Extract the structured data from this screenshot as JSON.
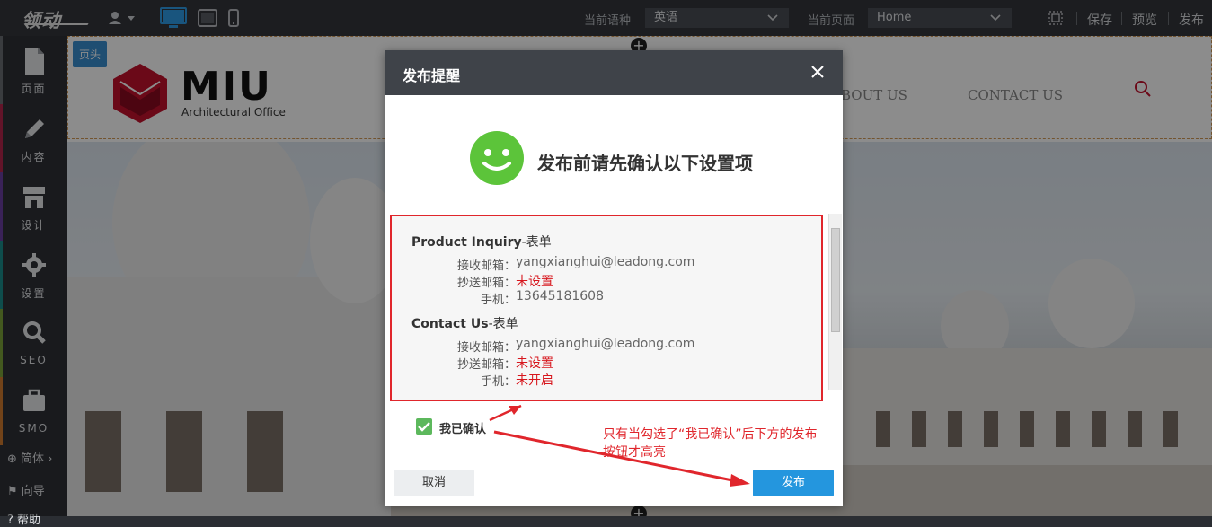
{
  "topbar": {
    "logo": "领动",
    "language_label": "当前语种",
    "language_value": "英语",
    "page_label": "当前页面",
    "page_value": "Home",
    "save": "保存",
    "preview": "预览",
    "publish": "发布"
  },
  "sidebar": {
    "items": [
      {
        "label": "页面",
        "icon": "page-icon",
        "color": "#6b6e73"
      },
      {
        "label": "内容",
        "icon": "pencil-icon",
        "color": "#b2264b"
      },
      {
        "label": "设计",
        "icon": "store-icon",
        "color": "#6a3fa0"
      },
      {
        "label": "设置",
        "icon": "gear-icon",
        "color": "#1b8d8b"
      },
      {
        "label": "SEO",
        "icon": "search-icon",
        "color": "#7aa33a"
      },
      {
        "label": "SMO",
        "icon": "briefcase-icon",
        "color": "#d07a2e"
      }
    ],
    "lang_switch": "简体",
    "guide": "向导",
    "help": "帮助"
  },
  "site": {
    "header_tag": "页头",
    "logo_title": "MIU",
    "logo_subtitle": "Architectural Office",
    "nav_about": "BOUT US",
    "nav_contact": "CONTACT US"
  },
  "dialog": {
    "title": "发布提醒",
    "headline": "发布前请先确认以下设置项",
    "forms": [
      {
        "name": "Product Inquiry",
        "suffix": "-表单",
        "rows": [
          {
            "label": "接收邮箱：",
            "value": "yangxianghui@leadong.com",
            "warn": false
          },
          {
            "label": "抄送邮箱：",
            "value": "未设置",
            "warn": true
          },
          {
            "label": "手机：",
            "value": "13645181608",
            "warn": false
          }
        ]
      },
      {
        "name": "Contact Us",
        "suffix": "-表单",
        "rows": [
          {
            "label": "接收邮箱：",
            "value": "yangxianghui@leadong.com",
            "warn": false
          },
          {
            "label": "抄送邮箱：",
            "value": "未设置",
            "warn": true
          },
          {
            "label": "手机：",
            "value": "未开启",
            "warn": true
          }
        ]
      }
    ],
    "confirm_label": "我已确认",
    "confirm_checked": true,
    "cancel": "取消",
    "publish": "发布"
  },
  "annotation": "只有当勾选了“我已确认”后下方的发布按钮才高亮",
  "colors": {
    "accent_red": "#e0262c",
    "publish_blue": "#2496de",
    "smile_green": "#5cc43a"
  }
}
